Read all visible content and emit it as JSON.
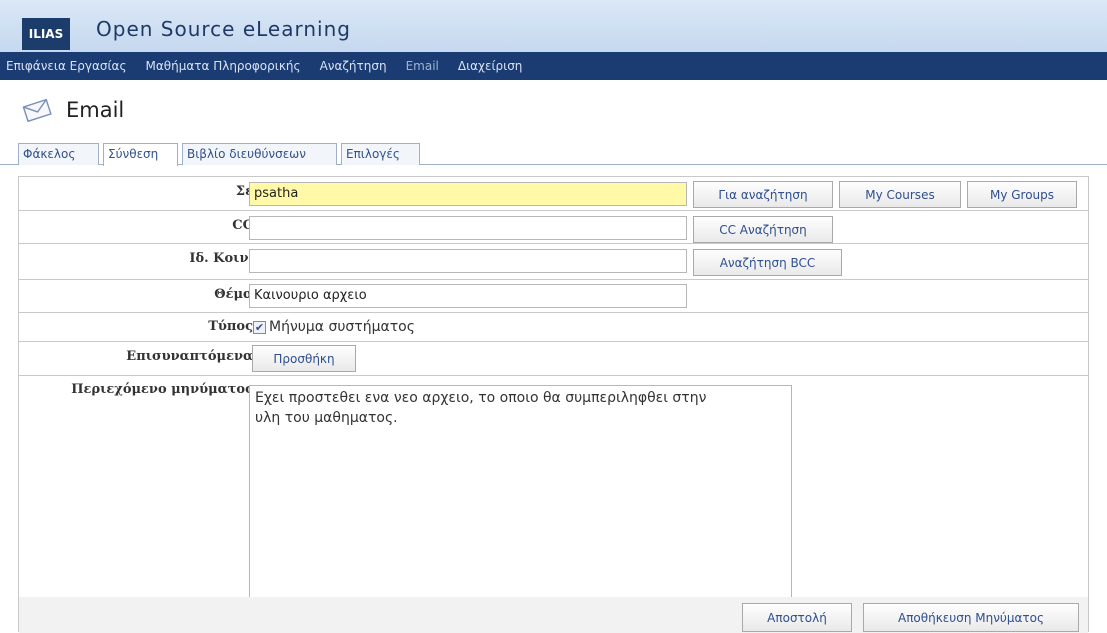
{
  "header": {
    "logo_text": "ILIAS",
    "brand": "Open Source eLearning"
  },
  "nav": {
    "items": [
      {
        "label": "Επιφάνεια Εργασίας"
      },
      {
        "label": "Μαθήματα Πληροφορικής"
      },
      {
        "label": "Αναζήτηση"
      },
      {
        "label": "Email"
      },
      {
        "label": "Διαχείριση"
      }
    ],
    "active": "Email"
  },
  "page": {
    "title": "Email",
    "icon": "envelope-icon"
  },
  "tabs": [
    {
      "label": "Φάκελος"
    },
    {
      "label": "Σύνθεση"
    },
    {
      "label": "Βιβλίο διευθύνσεων"
    },
    {
      "label": "Επιλογές"
    }
  ],
  "active_tab": "Σύνθεση",
  "form": {
    "to_label": "Σε",
    "to_value": "psatha",
    "to_search_button": "Για αναζήτηση",
    "my_courses_button": "My Courses",
    "my_groups_button": "My Groups",
    "cc_label": "CC",
    "cc_value": "",
    "cc_search_button": "CC Αναζήτηση",
    "bcc_label": "Ιδ. Κοιν.",
    "bcc_value": "",
    "bcc_search_button": "Αναζήτηση BCC",
    "subject_label": "Θέμα",
    "subject_value": "Καινουριο αρχειο",
    "type_label": "Τύπος",
    "type_option": "Μήνυμα συστήματος",
    "type_checked": true,
    "attachments_label": "Επισυναπτόμενα",
    "attachments_button": "Προσθήκη",
    "message_label": "Περιεχόμενο μηνύματος",
    "message_value": "Εχει προστεθει ενα νεο αρχειο, το οποιο θα συμπεριληφθει στην\nυλη του μαθηματος.",
    "send_button": "Αποστολή",
    "save_button": "Αποθήκευση Μηνύματος"
  },
  "colors": {
    "header_bg": "#c5d8ef",
    "nav_bg": "#1b3b73",
    "to_field_bg": "#fff9a8",
    "link_blue": "#2f4f8f"
  }
}
